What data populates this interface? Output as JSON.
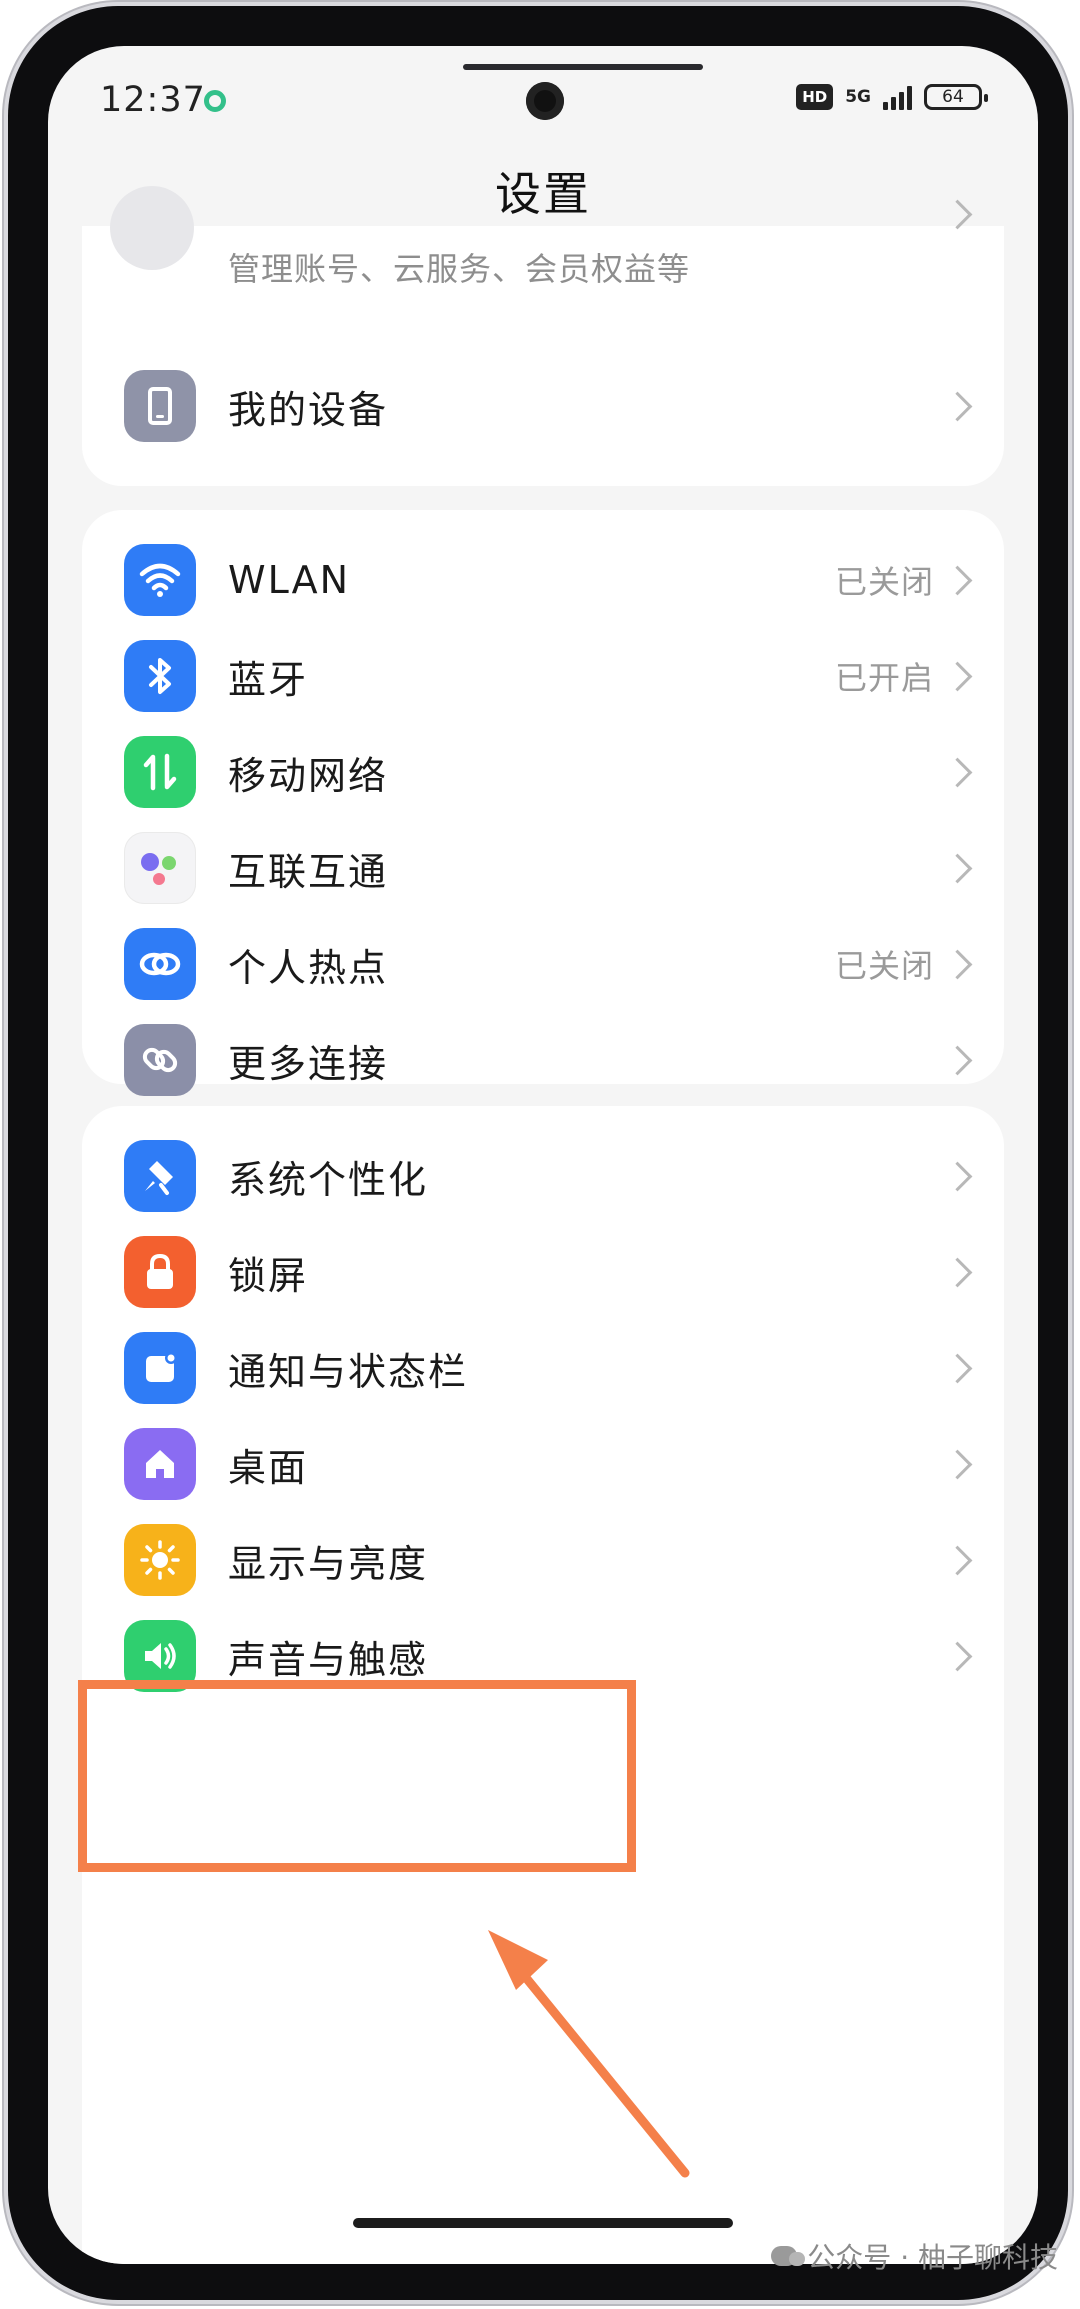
{
  "status_bar": {
    "time": "12:37",
    "hd": "HD",
    "network": "5G",
    "battery": "64"
  },
  "page_title": "设置",
  "account": {
    "subtitle": "管理账号、云服务、会员权益等"
  },
  "my_device": {
    "label": "我的设备"
  },
  "connectivity": [
    {
      "label": "WLAN",
      "status": "已关闭",
      "icon": "wifi-icon",
      "color": "#2f7cf6"
    },
    {
      "label": "蓝牙",
      "status": "已开启",
      "icon": "bluetooth-icon",
      "color": "#2f7cf6"
    },
    {
      "label": "移动网络",
      "status": "",
      "icon": "mobile-data-icon",
      "color": "#2fcf6f"
    },
    {
      "label": "互联互通",
      "status": "",
      "icon": "interconnect-icon",
      "color": "#f4f4f6"
    },
    {
      "label": "个人热点",
      "status": "已关闭",
      "icon": "hotspot-icon",
      "color": "#2f7cf6"
    },
    {
      "label": "更多连接",
      "status": "",
      "icon": "link-icon",
      "color": "#8b8fa8"
    }
  ],
  "personalization": [
    {
      "label": "系统个性化",
      "icon": "theme-icon",
      "color": "#2f7cf6"
    },
    {
      "label": "锁屏",
      "icon": "lock-icon",
      "color": "#f3602f"
    },
    {
      "label": "通知与状态栏",
      "icon": "notification-icon",
      "color": "#2f7cf6"
    },
    {
      "label": "桌面",
      "icon": "home-icon",
      "color": "#8a6cf2"
    },
    {
      "label": "显示与亮度",
      "icon": "brightness-icon",
      "color": "#f7b21a"
    },
    {
      "label": "声音与触感",
      "icon": "sound-icon",
      "color": "#2fcf6f"
    }
  ],
  "watermark": "公众号 · 柚子聊科技",
  "accent_color": "#f4804a"
}
